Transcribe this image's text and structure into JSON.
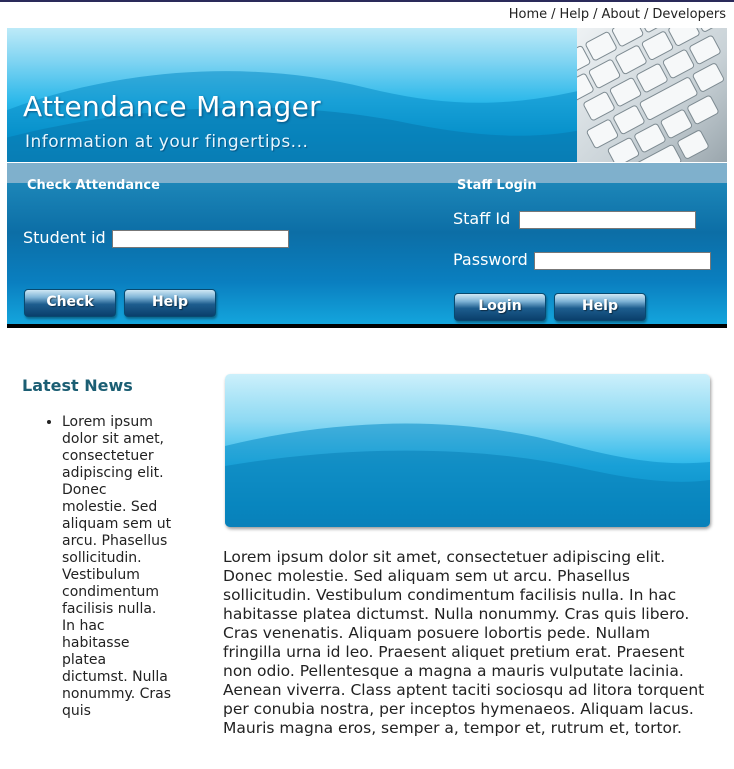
{
  "nav": {
    "home": "Home",
    "help": "Help",
    "about": "About",
    "developers": "Developers",
    "separator": "/"
  },
  "banner": {
    "title": "Attendance Manager",
    "tagline": "Information at your fingertips..."
  },
  "check_attendance": {
    "heading": "Check Attendance",
    "student_id_label": "Student id",
    "student_id_value": "",
    "check_button": "Check",
    "help_button": "Help"
  },
  "staff_login": {
    "heading": "Staff Login",
    "staff_id_label": "Staff Id",
    "staff_id_value": "",
    "password_label": "Password",
    "password_value": "",
    "login_button": "Login",
    "help_button": "Help"
  },
  "sidebar": {
    "title": "Latest News",
    "items": [
      "Lorem ipsum dolor sit amet, consectetuer adipiscing elit. Donec molestie. Sed aliquam sem ut arcu. Phasellus sollicitudin. Vestibulum condimentum facilisis nulla. In hac habitasse platea dictumst. Nulla nonummy. Cras quis"
    ]
  },
  "main": {
    "paragraph": "Lorem ipsum dolor sit amet, consectetuer adipiscing elit. Donec molestie. Sed aliquam sem ut arcu. Phasellus sollicitudin. Vestibulum condimentum facilisis nulla. In hac habitasse platea dictumst. Nulla nonummy. Cras quis libero. Cras venenatis. Aliquam posuere lobortis pede. Nullam fringilla urna id leo. Praesent aliquet pretium erat. Praesent non odio. Pellentesque a magna a mauris vulputate lacinia. Aenean viverra. Class aptent taciti sociosqu ad litora torquent per conubia nostra, per inceptos hymenaeos. Aliquam lacus. Mauris magna eros, semper a, tempor et, rutrum et, tortor."
  },
  "colors": {
    "accent": "#0a7fc0",
    "heading": "#1b5e73",
    "button": "#1d5d8e"
  }
}
